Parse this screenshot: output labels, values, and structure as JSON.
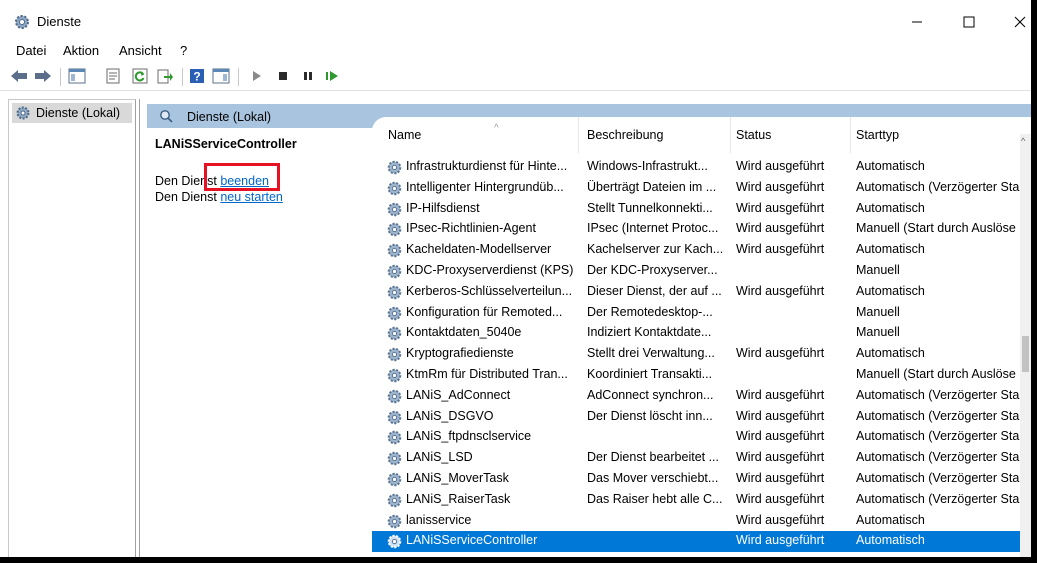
{
  "window": {
    "title": "Dienste"
  },
  "menu": {
    "items": [
      "Datei",
      "Aktion",
      "Ansicht",
      "?"
    ]
  },
  "tree": {
    "root_label": "Dienste (Lokal)"
  },
  "panel": {
    "header": "Dienste (Lokal)"
  },
  "detail": {
    "service_name": "LANiSServiceController",
    "line1_prefix": "Den Dienst ",
    "line1_link": "beenden",
    "line2_prefix": "Den Dienst ",
    "line2_link": "neu starten"
  },
  "columns": {
    "name": "Name",
    "description": "Beschreibung",
    "status": "Status",
    "startup": "Starttyp"
  },
  "rows": [
    {
      "name": "Infrastrukturdienst für Hinte...",
      "description": "Windows-Infrastrukt...",
      "status": "Wird ausgeführt",
      "startup": "Automatisch"
    },
    {
      "name": "Intelligenter Hintergrundüb...",
      "description": "Überträgt Dateien im ...",
      "status": "Wird ausgeführt",
      "startup": "Automatisch (Verzögerter Sta"
    },
    {
      "name": "IP-Hilfsdienst",
      "description": "Stellt Tunnelkonnekti...",
      "status": "Wird ausgeführt",
      "startup": "Automatisch"
    },
    {
      "name": "IPsec-Richtlinien-Agent",
      "description": "IPsec (Internet Protoc...",
      "status": "Wird ausgeführt",
      "startup": "Manuell (Start durch Auslöse"
    },
    {
      "name": "Kacheldaten-Modellserver",
      "description": "Kachelserver zur Kach...",
      "status": "Wird ausgeführt",
      "startup": "Automatisch"
    },
    {
      "name": "KDC-Proxyserverdienst (KPS)",
      "description": "Der KDC-Proxyserver...",
      "status": "",
      "startup": "Manuell"
    },
    {
      "name": "Kerberos-Schlüsselverteilun...",
      "description": "Dieser Dienst, der auf ...",
      "status": "Wird ausgeführt",
      "startup": "Automatisch"
    },
    {
      "name": "Konfiguration für Remoted...",
      "description": "Der Remotedesktop-...",
      "status": "",
      "startup": "Manuell"
    },
    {
      "name": "Kontaktdaten_5040e",
      "description": "Indiziert Kontaktdate...",
      "status": "",
      "startup": "Manuell"
    },
    {
      "name": "Kryptografiedienste",
      "description": "Stellt drei Verwaltung...",
      "status": "Wird ausgeführt",
      "startup": "Automatisch"
    },
    {
      "name": "KtmRm für Distributed Tran...",
      "description": "Koordiniert Transakti...",
      "status": "",
      "startup": "Manuell (Start durch Auslöse"
    },
    {
      "name": "LANiS_AdConnect",
      "description": "AdConnect synchron...",
      "status": "Wird ausgeführt",
      "startup": "Automatisch (Verzögerter Sta"
    },
    {
      "name": "LANiS_DSGVO",
      "description": "Der Dienst löscht inn...",
      "status": "Wird ausgeführt",
      "startup": "Automatisch (Verzögerter Sta"
    },
    {
      "name": "LANiS_ftpdnsclservice",
      "description": "",
      "status": "Wird ausgeführt",
      "startup": "Automatisch (Verzögerter Sta"
    },
    {
      "name": "LANiS_LSD",
      "description": "Der Dienst bearbeitet ...",
      "status": "Wird ausgeführt",
      "startup": "Automatisch (Verzögerter Sta"
    },
    {
      "name": "LANiS_MoverTask",
      "description": "Das Mover verschiebt...",
      "status": "Wird ausgeführt",
      "startup": "Automatisch (Verzögerter Sta"
    },
    {
      "name": "LANiS_RaiserTask",
      "description": "Das Raiser hebt alle C...",
      "status": "Wird ausgeführt",
      "startup": "Automatisch (Verzögerter Sta"
    },
    {
      "name": "lanisservice",
      "description": "",
      "status": "Wird ausgeführt",
      "startup": "Automatisch"
    },
    {
      "name": "LANiSServiceController",
      "description": "",
      "status": "Wird ausgeführt",
      "startup": "Automatisch",
      "selected": true
    }
  ],
  "colors": {
    "selection": "#0078d7",
    "panel_header": "#a9c4de",
    "highlight": "#e81123",
    "link": "#0066cc"
  }
}
